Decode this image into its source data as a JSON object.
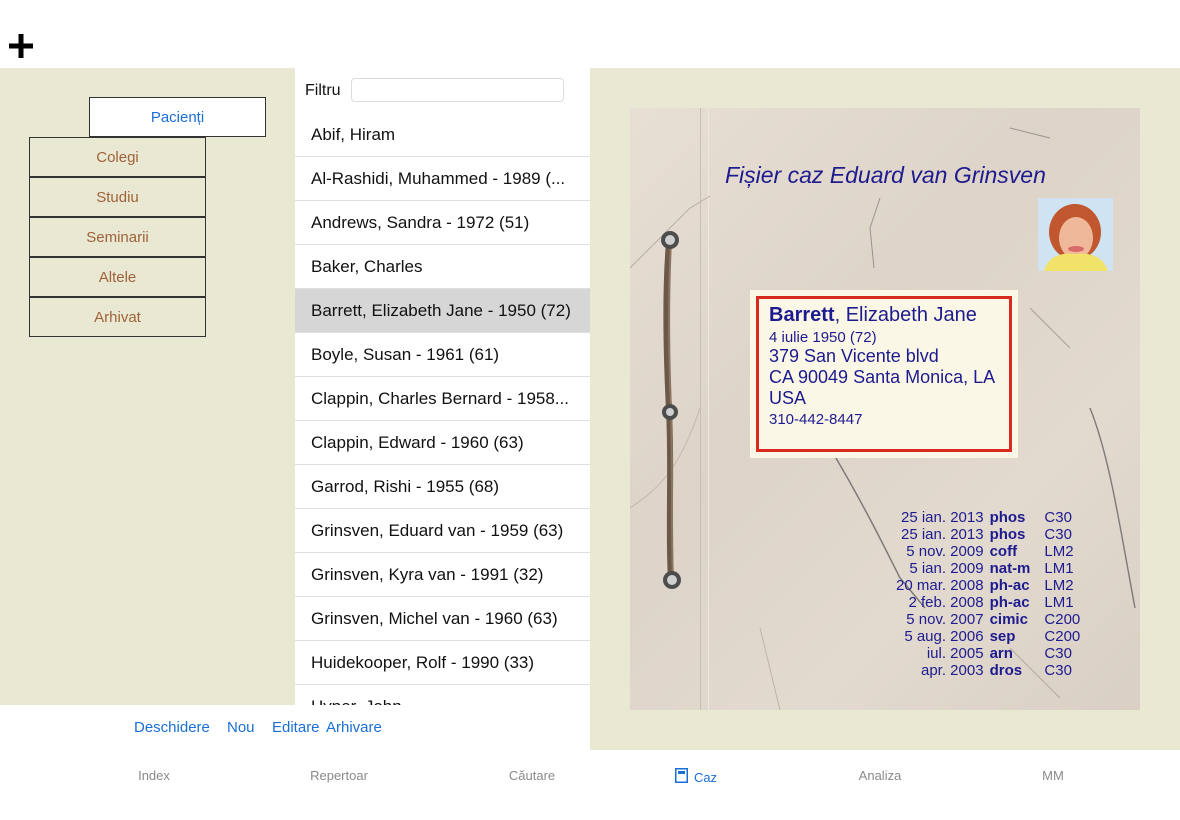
{
  "categories": {
    "active": "Pacienți",
    "items": [
      "Colegi",
      "Studiu",
      "Seminarii",
      "Altele",
      "Arhivat"
    ]
  },
  "filter": {
    "label": "Filtru",
    "value": ""
  },
  "patients": [
    "Abif, Hiram",
    "Al-Rashidi, Muhammed - 1989 (...",
    "Andrews, Sandra - 1972 (51)",
    "Baker, Charles",
    "Barrett, Elizabeth Jane - 1950 (72)",
    "Boyle, Susan - 1961 (61)",
    "Clappin, Charles Bernard - 1958...",
    "Clappin, Edward - 1960 (63)",
    "Garrod, Rishi - 1955 (68)",
    "Grinsven, Eduard van - 1959 (63)",
    "Grinsven, Kyra van - 1991 (32)",
    "Grinsven, Michel van - 1960 (63)",
    "Huidekooper, Rolf - 1990 (33)",
    "Hyper, John"
  ],
  "selected_patient_index": 4,
  "actions": {
    "open": "Deschidere",
    "new": "Nou",
    "edit": "Editare",
    "archive": "Arhivare"
  },
  "case": {
    "title": "Fișier caz Eduard van Grinsven",
    "surname": "Barrett",
    "given_names": ", Elizabeth Jane",
    "birth": "4 iulie 1950 (72)",
    "address": [
      "379 San Vicente blvd",
      "CA 90049  Santa Monica, LA",
      "USA"
    ],
    "phone": "310-442-8447",
    "consultations": [
      {
        "date": "25 ian. 2013",
        "remedy": "phos",
        "potency": "C30"
      },
      {
        "date": "25 ian. 2013",
        "remedy": "phos",
        "potency": "C30"
      },
      {
        "date": "5 nov. 2009",
        "remedy": "coff",
        "potency": "LM2"
      },
      {
        "date": "5 ian. 2009",
        "remedy": "nat-m",
        "potency": "LM1"
      },
      {
        "date": "20 mar. 2008",
        "remedy": "ph-ac",
        "potency": "LM2"
      },
      {
        "date": "2 feb. 2008",
        "remedy": "ph-ac",
        "potency": "LM1"
      },
      {
        "date": "5 nov. 2007",
        "remedy": "cimic",
        "potency": "C200"
      },
      {
        "date": "5 aug. 2006",
        "remedy": "sep",
        "potency": "C200"
      },
      {
        "date": "iul. 2005",
        "remedy": "arn",
        "potency": "C30"
      },
      {
        "date": "apr. 2003",
        "remedy": "dros",
        "potency": "C30"
      }
    ]
  },
  "tabs": {
    "index": "Index",
    "repertory": "Repertoar",
    "search": "Căutare",
    "case": "Caz",
    "analysis": "Analiza",
    "mm": "MM"
  },
  "colors": {
    "accent": "#1a6fd6",
    "ink": "#1d1b8f",
    "frame": "#d62a1c",
    "panel": "#e9e8d3"
  }
}
